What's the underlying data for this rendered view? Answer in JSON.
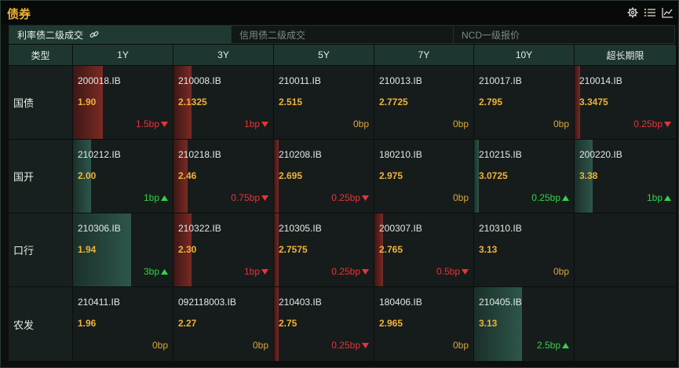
{
  "header": {
    "title": "债券"
  },
  "tabs": [
    {
      "label": "利率债二级成交",
      "active": true
    },
    {
      "label": "信用债二级成交",
      "active": false
    },
    {
      "label": "NCD一级报价",
      "active": false
    }
  ],
  "table": {
    "columns": [
      "类型",
      "1Y",
      "3Y",
      "5Y",
      "7Y",
      "10Y",
      "超长期限"
    ],
    "rows": [
      {
        "label": "国债",
        "cells": [
          {
            "code": "200018.IB",
            "yield": "1.90",
            "change": "1.5bp",
            "dir": "up",
            "level": 0.3
          },
          {
            "code": "210008.IB",
            "yield": "2.1325",
            "change": "1bp",
            "dir": "up",
            "level": 0.18
          },
          {
            "code": "210011.IB",
            "yield": "2.515",
            "change": "0bp",
            "dir": "flat",
            "level": 0
          },
          {
            "code": "210013.IB",
            "yield": "2.7725",
            "change": "0bp",
            "dir": "flat",
            "level": 0
          },
          {
            "code": "210017.IB",
            "yield": "2.795",
            "change": "0bp",
            "dir": "flat",
            "level": 0
          },
          {
            "code": "210014.IB",
            "yield": "3.3475",
            "change": "0.25bp",
            "dir": "up",
            "level": 0.05
          }
        ]
      },
      {
        "label": "国开",
        "cells": [
          {
            "code": "210212.IB",
            "yield": "2.00",
            "change": "1bp",
            "dir": "down",
            "level": 0.18
          },
          {
            "code": "210218.IB",
            "yield": "2.46",
            "change": "0.75bp",
            "dir": "up",
            "level": 0.14
          },
          {
            "code": "210208.IB",
            "yield": "2.695",
            "change": "0.25bp",
            "dir": "up",
            "level": 0.05
          },
          {
            "code": "180210.IB",
            "yield": "2.975",
            "change": "0bp",
            "dir": "flat",
            "level": 0
          },
          {
            "code": "210215.IB",
            "yield": "3.0725",
            "change": "0.25bp",
            "dir": "down",
            "level": 0.05
          },
          {
            "code": "200220.IB",
            "yield": "3.38",
            "change": "1bp",
            "dir": "down",
            "level": 0.18
          }
        ]
      },
      {
        "label": "口行",
        "cells": [
          {
            "code": "210306.IB",
            "yield": "1.94",
            "change": "3bp",
            "dir": "down",
            "level": 0.58
          },
          {
            "code": "210322.IB",
            "yield": "2.30",
            "change": "1bp",
            "dir": "up",
            "level": 0.18
          },
          {
            "code": "210305.IB",
            "yield": "2.7575",
            "change": "0.25bp",
            "dir": "up",
            "level": 0.05
          },
          {
            "code": "200307.IB",
            "yield": "2.765",
            "change": "0.5bp",
            "dir": "up",
            "level": 0.09
          },
          {
            "code": "210310.IB",
            "yield": "3.13",
            "change": "0bp",
            "dir": "flat",
            "level": 0
          },
          {
            "empty": true
          }
        ]
      },
      {
        "label": "农发",
        "cells": [
          {
            "code": "210411.IB",
            "yield": "1.96",
            "change": "0bp",
            "dir": "flat",
            "level": 0
          },
          {
            "code": "092118003.IB",
            "yield": "2.27",
            "change": "0bp",
            "dir": "flat",
            "level": 0
          },
          {
            "code": "210403.IB",
            "yield": "2.75",
            "change": "0.25bp",
            "dir": "up",
            "level": 0.05
          },
          {
            "code": "180406.IB",
            "yield": "2.965",
            "change": "0bp",
            "dir": "flat",
            "level": 0
          },
          {
            "code": "210405.IB",
            "yield": "3.13",
            "change": "2.5bp",
            "dir": "down",
            "level": 0.48
          },
          {
            "empty": true
          }
        ]
      }
    ]
  },
  "icons": {
    "settings": "gear-icon",
    "list": "list-icon",
    "chart": "line-chart-icon",
    "link": "link-icon"
  },
  "colors": {
    "accent": "#f0b23a",
    "up": "#e8333a",
    "down": "#33d14a",
    "flat": "#d8a742",
    "header": "#1d3630"
  }
}
